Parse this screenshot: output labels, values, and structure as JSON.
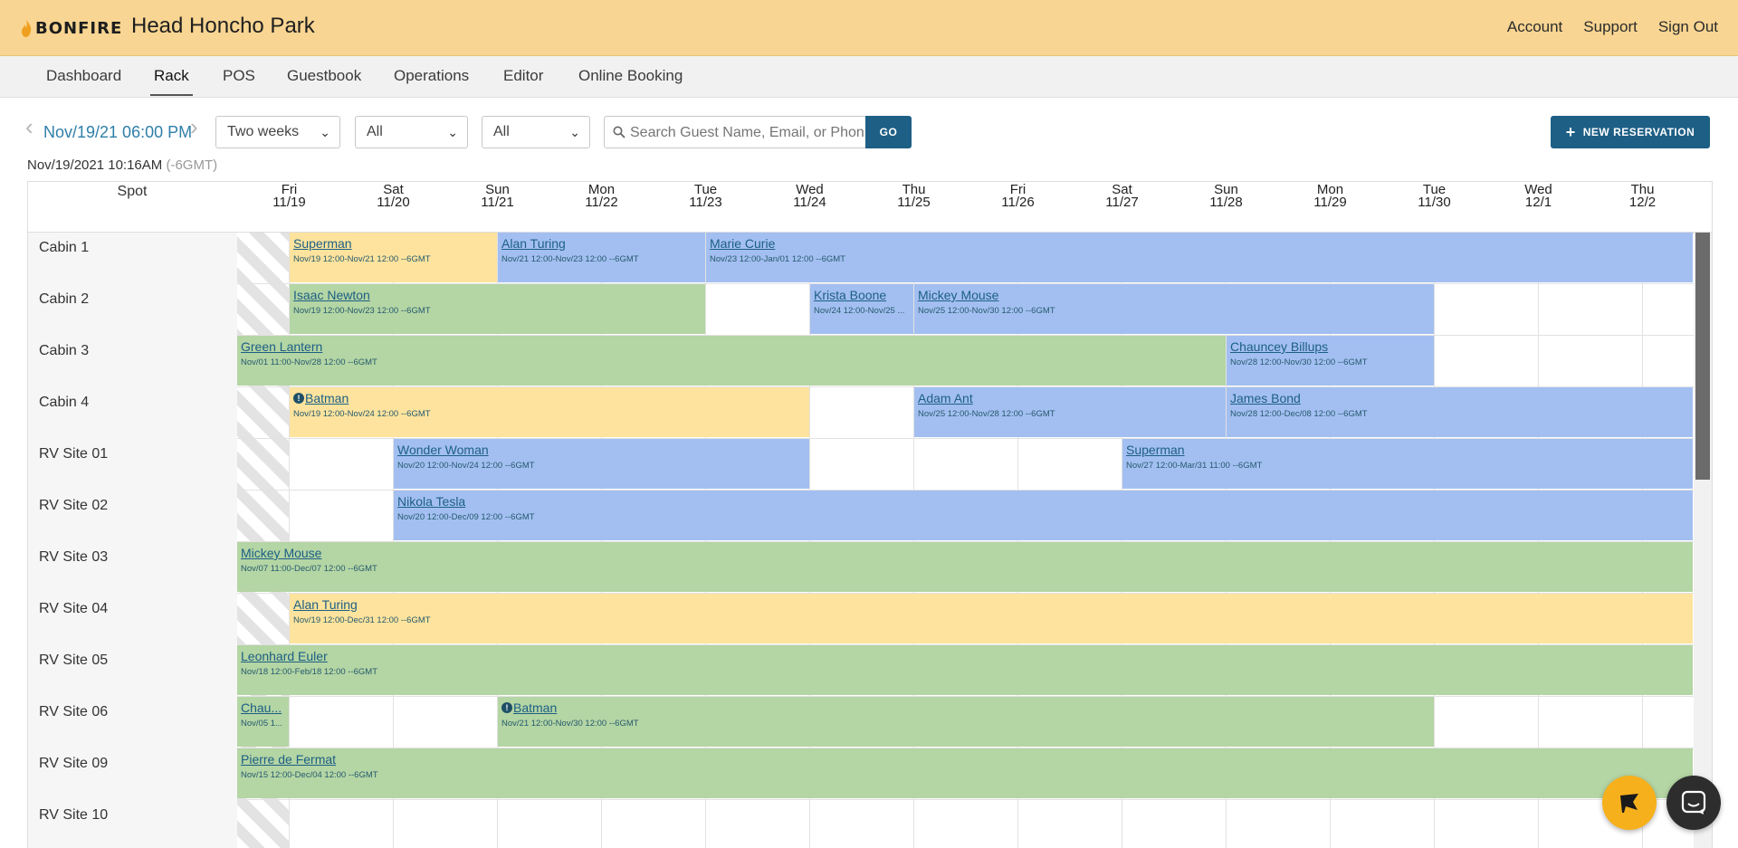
{
  "brand": {
    "logo_text": "BONFIRE",
    "park_name": "Head Honcho Park",
    "accent": "#f8d592"
  },
  "top_links": [
    "Account",
    "Support",
    "Sign Out"
  ],
  "nav": {
    "tabs": [
      "Dashboard",
      "Rack",
      "POS",
      "Guestbook",
      "Operations",
      "Editor",
      "Online Booking"
    ],
    "active": "Rack"
  },
  "toolbar": {
    "current_date": "Nov/19/21 06:00 PM",
    "range_select": "Two weeks",
    "filter1": "All",
    "filter2": "All",
    "search_placeholder": "Search Guest Name, Email, or Phone",
    "go_label": "GO",
    "new_reservation_label": "NEW RESERVATION",
    "now_text": "Nov/19/2021 10:16AM",
    "now_tz": "(-6GMT)"
  },
  "grid": {
    "spot_header": "Spot",
    "days": [
      {
        "dow": "Fri",
        "date": "11/19"
      },
      {
        "dow": "Sat",
        "date": "11/20"
      },
      {
        "dow": "Sun",
        "date": "11/21"
      },
      {
        "dow": "Mon",
        "date": "11/22"
      },
      {
        "dow": "Tue",
        "date": "11/23"
      },
      {
        "dow": "Wed",
        "date": "11/24"
      },
      {
        "dow": "Thu",
        "date": "11/25"
      },
      {
        "dow": "Fri",
        "date": "11/26"
      },
      {
        "dow": "Sat",
        "date": "11/27"
      },
      {
        "dow": "Sun",
        "date": "11/28"
      },
      {
        "dow": "Mon",
        "date": "11/29"
      },
      {
        "dow": "Tue",
        "date": "11/30"
      },
      {
        "dow": "Wed",
        "date": "12/1"
      },
      {
        "dow": "Thu",
        "date": "12/2"
      }
    ],
    "spots": [
      "Cabin 1",
      "Cabin 2",
      "Cabin 3",
      "Cabin 4",
      "RV Site 01",
      "RV Site 02",
      "RV Site 03",
      "RV Site 04",
      "RV Site 05",
      "RV Site 06",
      "RV Site 09",
      "RV Site 10"
    ],
    "reservations": [
      {
        "row": 0,
        "start": 0.5,
        "end": 2.5,
        "color": "yellow",
        "name": "Superman",
        "dates": "Nov/19 12:00-Nov/21 12:00 --6GMT"
      },
      {
        "row": 0,
        "start": 2.5,
        "end": 4.5,
        "color": "blue",
        "name": "Alan Turing",
        "dates": "Nov/21 12:00-Nov/23 12:00 --6GMT"
      },
      {
        "row": 0,
        "start": 4.5,
        "end": 14,
        "color": "blue",
        "name": "Marie Curie",
        "dates": "Nov/23 12:00-Jan/01 12:00 --6GMT"
      },
      {
        "row": 1,
        "start": 0.5,
        "end": 4.5,
        "color": "green",
        "name": "Isaac Newton",
        "dates": "Nov/19 12:00-Nov/23 12:00 --6GMT"
      },
      {
        "row": 1,
        "start": 5.5,
        "end": 6.5,
        "color": "blue",
        "name": "Krista Boone",
        "dates": "Nov/24 12:00-Nov/25 ..."
      },
      {
        "row": 1,
        "start": 6.5,
        "end": 11.5,
        "color": "blue",
        "name": "Mickey Mouse",
        "dates": "Nov/25 12:00-Nov/30 12:00 --6GMT"
      },
      {
        "row": 2,
        "start": 0,
        "end": 9.5,
        "color": "green",
        "name": "Green Lantern",
        "dates": "Nov/01 11:00-Nov/28 12:00 --6GMT"
      },
      {
        "row": 2,
        "start": 9.5,
        "end": 11.5,
        "color": "blue",
        "name": "Chauncey Billups",
        "dates": "Nov/28 12:00-Nov/30 12:00 --6GMT"
      },
      {
        "row": 3,
        "start": 0.5,
        "end": 5.5,
        "color": "yellow",
        "name": "Batman",
        "alert": true,
        "dates": "Nov/19 12:00-Nov/24 12:00 --6GMT"
      },
      {
        "row": 3,
        "start": 6.5,
        "end": 9.5,
        "color": "blue",
        "name": "Adam Ant",
        "dates": "Nov/25 12:00-Nov/28 12:00 --6GMT"
      },
      {
        "row": 3,
        "start": 9.5,
        "end": 14,
        "color": "blue",
        "name": "James Bond",
        "dates": "Nov/28 12:00-Dec/08 12:00 --6GMT"
      },
      {
        "row": 4,
        "start": 1.5,
        "end": 5.5,
        "color": "blue",
        "name": "Wonder Woman",
        "dates": "Nov/20 12:00-Nov/24 12:00 --6GMT"
      },
      {
        "row": 4,
        "start": 8.5,
        "end": 14,
        "color": "blue",
        "name": "Superman",
        "dates": "Nov/27 12:00-Mar/31 11:00 --6GMT"
      },
      {
        "row": 5,
        "start": 1.5,
        "end": 14,
        "color": "blue",
        "name": "Nikola Tesla",
        "dates": "Nov/20 12:00-Dec/09 12:00 --6GMT"
      },
      {
        "row": 6,
        "start": 0,
        "end": 14,
        "color": "green",
        "name": "Mickey Mouse",
        "dates": "Nov/07 11:00-Dec/07 12:00 --6GMT"
      },
      {
        "row": 7,
        "start": 0.5,
        "end": 14,
        "color": "yellow",
        "name": "Alan Turing",
        "dates": "Nov/19 12:00-Dec/31 12:00 --6GMT"
      },
      {
        "row": 8,
        "start": 0,
        "end": 14,
        "color": "green",
        "name": "Leonhard Euler",
        "dates": "Nov/18 12:00-Feb/18 12:00 --6GMT"
      },
      {
        "row": 9,
        "start": 0,
        "end": 0.5,
        "color": "green",
        "name": "Chau...",
        "dates": "Nov/05 1..."
      },
      {
        "row": 9,
        "start": 2.5,
        "end": 11.5,
        "color": "green",
        "name": "Batman",
        "alert": true,
        "dates": "Nov/21 12:00-Nov/30 12:00 --6GMT"
      },
      {
        "row": 10,
        "start": 0,
        "end": 14,
        "color": "green",
        "name": "Pierre de Fermat",
        "dates": "Nov/15 12:00-Dec/04 12:00 --6GMT"
      }
    ]
  },
  "colors": {
    "green": "#b4d5a4",
    "blue": "#a3bff1",
    "yellow": "#fde39d",
    "primary_button": "#1e5f85"
  },
  "widgets": [
    "flag-icon",
    "chat-icon"
  ]
}
